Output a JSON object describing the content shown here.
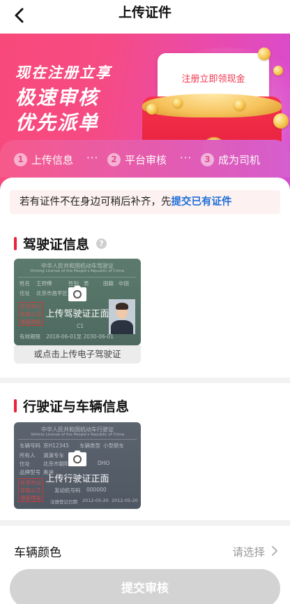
{
  "header": {
    "title": "上传证件",
    "back_icon": "chevron-left-icon"
  },
  "banner": {
    "slogan_line1": "现在注册立享",
    "slogan_line2": "极速审核",
    "slogan_line3": "优先派单",
    "coupon_text": "注册立即领现金",
    "colors": {
      "gradient_start": "#f9497a",
      "gradient_end": "#d64bd3"
    }
  },
  "steps": [
    {
      "num": "1",
      "label": "上传信息"
    },
    {
      "num": "2",
      "label": "平台审核"
    },
    {
      "num": "3",
      "label": "成为司机"
    }
  ],
  "step_separator": "···",
  "notice": {
    "text": "若有证件不在身边可稍后补齐，先",
    "link": "提交已有证件"
  },
  "driver_section": {
    "title": "驾驶证信息",
    "help_icon": "question-icon",
    "card": {
      "doc_title": "中华人民共和国机动车驾驶证",
      "doc_subtitle": "Driving License of the People's Republic of China",
      "name": "王师傅",
      "gender": "男",
      "nationality": "中国",
      "address": "北京市昌平区",
      "stamp": "北京市公安局公交通管理局",
      "class": "C1",
      "valid": "2018-06-01至 2030-06-01",
      "upload_label": "上传驾驶证正面",
      "camera_icon": "camera-icon"
    },
    "alt_action": "或点击上传电子驾驶证"
  },
  "vehicle_section": {
    "title": "行驶证与车辆信息",
    "card": {
      "doc_title": "中华人民共和国机动车行驶证",
      "doc_subtitle": "Vehicle License of the People's Republic of China",
      "plate": "京H12345",
      "vehicle_type": "小型轿车",
      "owner": "滴滴专车",
      "address": "北京市朝阳",
      "model": "奥迪",
      "brand_code": "DHO",
      "engine": "000000",
      "stamp": "北京市公安局公交通管理局",
      "register_date": "2012-05-20",
      "issue_date": "2012-05-20",
      "upload_label": "上传行驶证正面",
      "camera_icon": "camera-icon"
    }
  },
  "vehicle_color": {
    "label": "车辆颜色",
    "placeholder": "请选择",
    "chevron_icon": "chevron-right-icon"
  },
  "submit": {
    "label": "提交审核"
  },
  "colors": {
    "accent_red": "#e8233a",
    "link_blue": "#1e6fd9",
    "disabled_button": "#d3d3d3"
  }
}
